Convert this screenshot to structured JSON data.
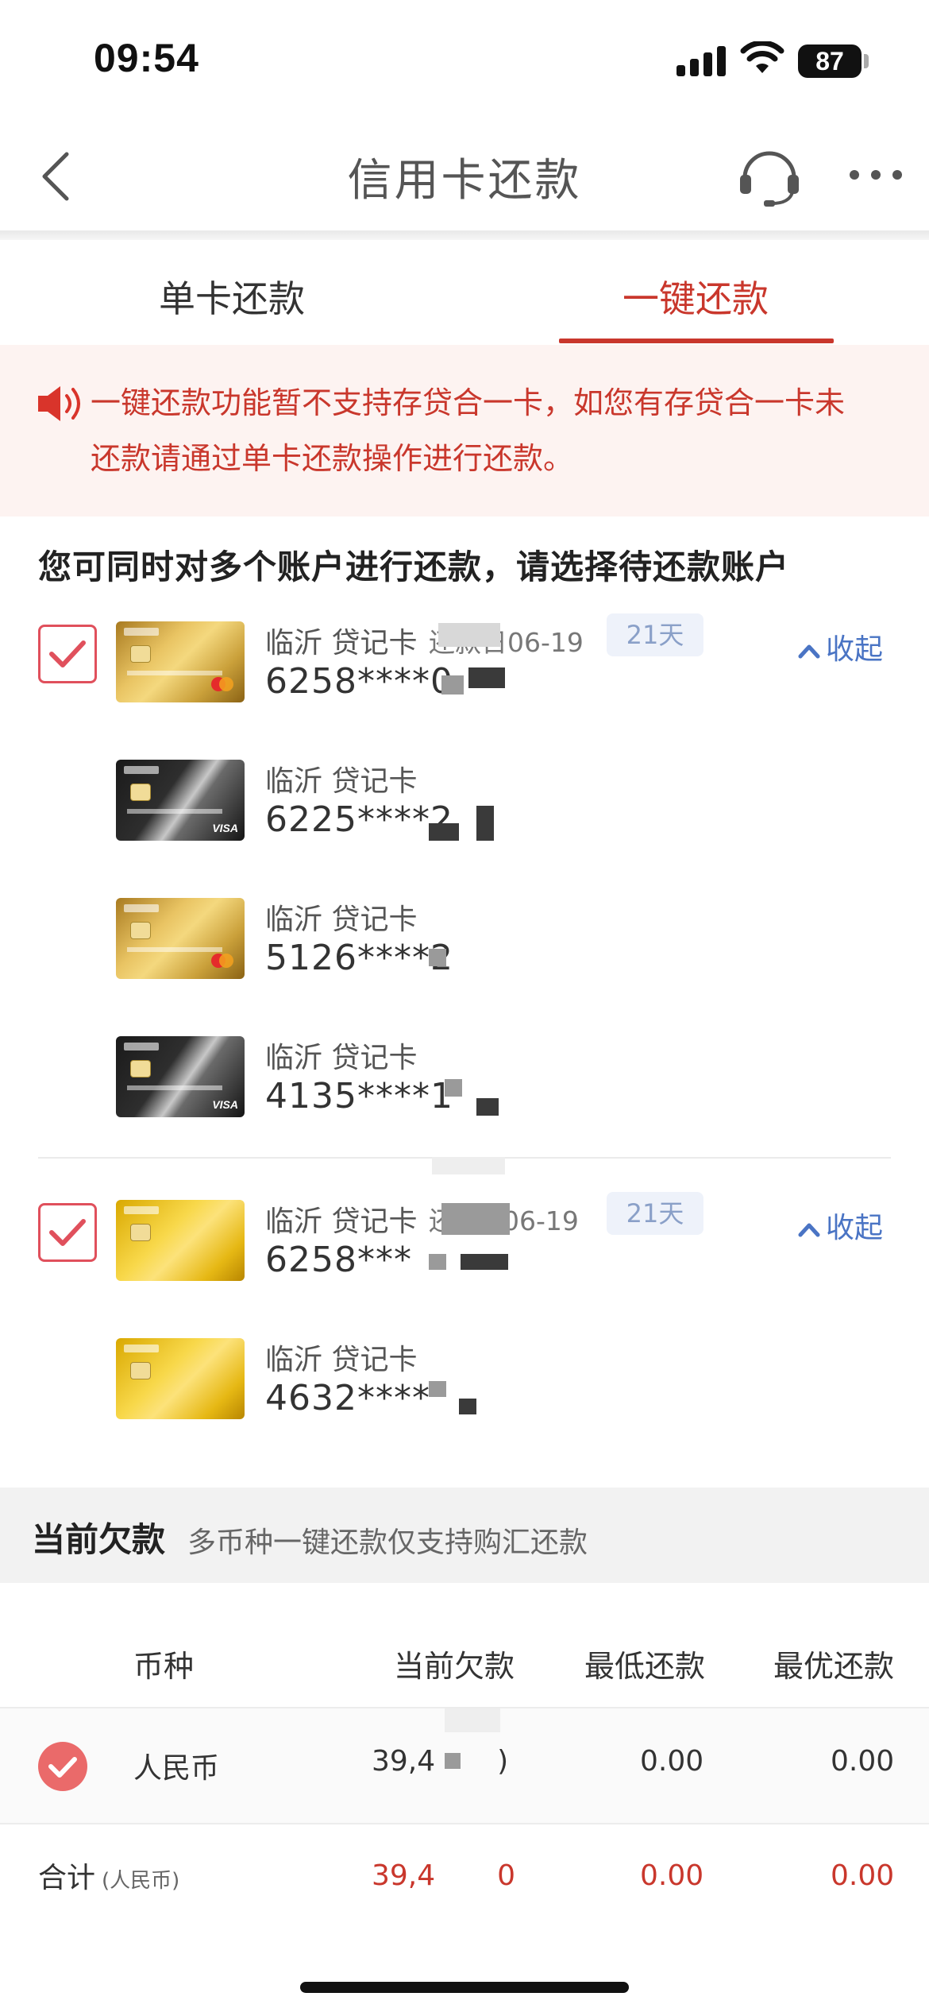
{
  "status_bar": {
    "time": "09:54",
    "battery": "87"
  },
  "nav": {
    "title": "信用卡还款",
    "back_icon": "chevron-left-icon",
    "service_icon": "headset-icon",
    "more_icon": "more-dots-icon"
  },
  "tabs": [
    {
      "label": "单卡还款",
      "active": false
    },
    {
      "label": "一键还款",
      "active": true
    }
  ],
  "notice": {
    "icon": "speaker-icon",
    "line1": "一键还款功能暂不支持存贷合一卡，如您有存贷合一卡未",
    "line2": "还款请通过单卡还款操作进行还款。"
  },
  "section_title": "您可同时对多个账户进行还款，请选择待还款账户",
  "groups": [
    {
      "checked": true,
      "collapse_label": "收起",
      "cards": [
        {
          "name": "临沂 贷记卡",
          "due_prefix": "还款日",
          "due_date": "06-19",
          "days": "21天",
          "number": "6258****0",
          "style": "gold"
        },
        {
          "name": "临沂 贷记卡",
          "number": "6225****2",
          "style": "black"
        },
        {
          "name": "临沂 贷记卡",
          "number": "5126****2",
          "style": "gold"
        },
        {
          "name": "临沂 贷记卡",
          "number": "4135****1",
          "style": "black"
        }
      ]
    },
    {
      "checked": true,
      "collapse_label": "收起",
      "cards": [
        {
          "name": "临沂 贷记卡",
          "due_prefix": "还",
          "due_date": "06-19",
          "days": "21天",
          "number": "6258***",
          "style": "yellow"
        },
        {
          "name": "临沂 贷记卡",
          "number": "4632****",
          "style": "yellow"
        }
      ]
    }
  ],
  "debt": {
    "title": "当前欠款",
    "subtitle": "多币种一键还款仅支持购汇还款",
    "columns": [
      "币种",
      "当前欠款",
      "最低还款",
      "最优还款"
    ],
    "rows": [
      {
        "currency": "人民币",
        "current": "39,4",
        "current_tail": ")",
        "minimum": "0.00",
        "optimal": "0.00",
        "checked": true
      }
    ],
    "total": {
      "label": "合计",
      "unit": "(人民币)",
      "current": "39,4",
      "current_tail": "0",
      "minimum": "0.00",
      "optimal": "0.00"
    }
  },
  "colors": {
    "accent": "#c9372c",
    "link": "#4a74c4",
    "notice_bg": "#fdf3f1",
    "checkbox": "#e0505c"
  }
}
